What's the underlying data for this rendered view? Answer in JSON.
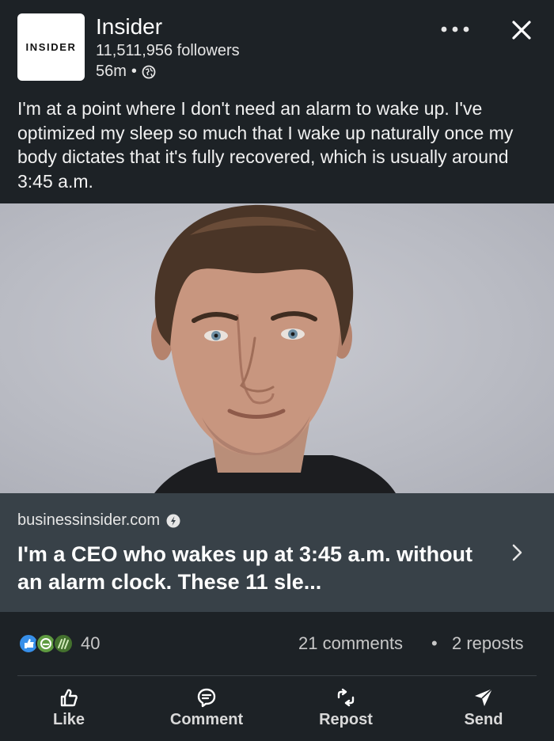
{
  "post": {
    "author": "Insider",
    "logo_text": "INSIDER",
    "followers": "11,511,956 followers",
    "time": "56m",
    "separator": "•",
    "text": "I'm at a point where I don't need an alarm to wake up. I've optimized my sleep so much that I wake up naturally once my body dictates that it's fully recovered, which is usually around 3:45 a.m."
  },
  "link": {
    "domain": "businessinsider.com",
    "headline": "I'm a CEO who wakes up at 3:45 a.m. without an alarm clock. These 11 sle..."
  },
  "stats": {
    "reactions": "40",
    "comments": "21 comments",
    "dot": "•",
    "reposts": "2 reposts"
  },
  "actions": {
    "like": "Like",
    "comment": "Comment",
    "repost": "Repost",
    "send": "Send"
  }
}
